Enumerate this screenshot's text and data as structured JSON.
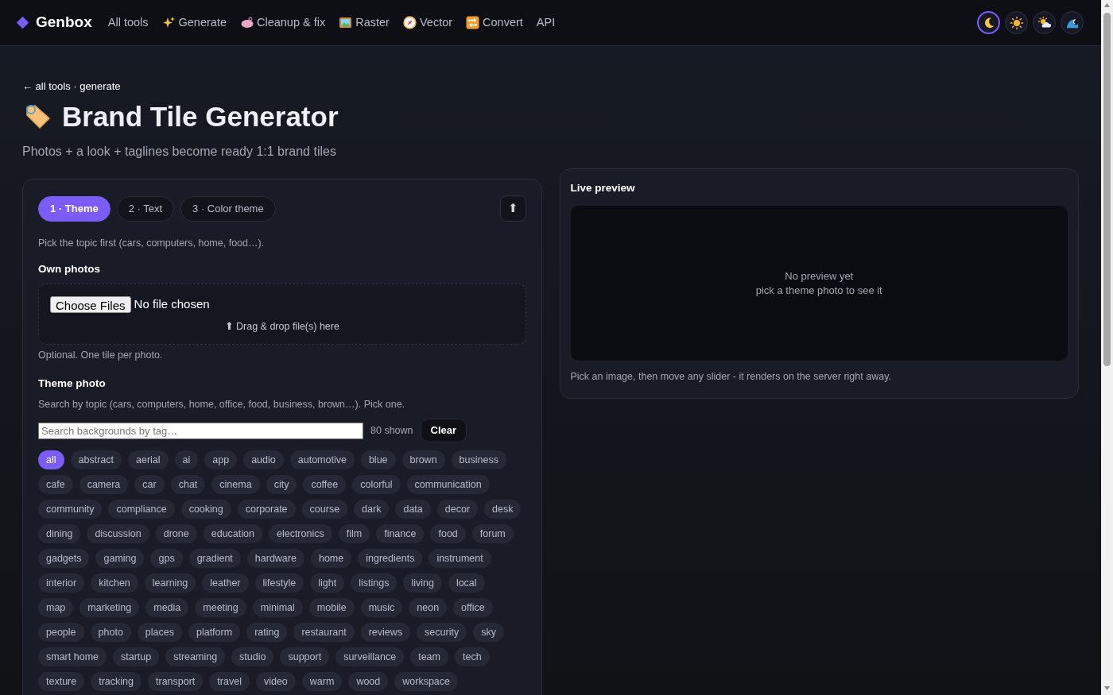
{
  "brand": {
    "name": "Genbox"
  },
  "nav": [
    {
      "label": "All tools",
      "kind": "plain"
    },
    {
      "label": "Generate",
      "kind": "sparkles"
    },
    {
      "label": "Cleanup & fix",
      "kind": "soap"
    },
    {
      "label": "Raster",
      "kind": "picture"
    },
    {
      "label": "Vector",
      "kind": "compass"
    },
    {
      "label": "Convert",
      "kind": "repeat"
    },
    {
      "label": "API",
      "kind": "plain"
    }
  ],
  "themes": [
    {
      "kind": "moon",
      "selected": true
    },
    {
      "kind": "sun",
      "selected": false
    },
    {
      "kind": "sun-cloud",
      "selected": false
    },
    {
      "kind": "wave",
      "selected": false
    }
  ],
  "breadcrumb": "← all tools · generate",
  "page_title": "Brand Tile Generator",
  "subtitle": "Photos + a look + taglines become ready 1:1 brand tiles",
  "steps": [
    {
      "label": "1 · Theme",
      "selected": true
    },
    {
      "label": "2 · Text",
      "selected": false
    },
    {
      "label": "3 · Color theme",
      "selected": false
    }
  ],
  "upload_button": "⬆",
  "step_hint": "Pick the topic first (cars, computers, home, food…).",
  "own_photos": {
    "heading": "Own photos",
    "choose_button": "Choose Files",
    "file_status": "No file chosen",
    "drop_hint": "⬆ Drag & drop file(s) here",
    "note": "Optional. One tile per photo."
  },
  "theme_photo": {
    "heading": "Theme photo",
    "hint": "Search by topic (cars, computers, home, office, food, business, brown…). Pick one.",
    "search": {
      "placeholder": "Search backgrounds by tag…"
    },
    "count": "80 shown",
    "clear_button": "Clear",
    "tags": [
      {
        "label": "all",
        "selected": true
      },
      {
        "label": "abstract",
        "selected": false
      },
      {
        "label": "aerial",
        "selected": false
      },
      {
        "label": "ai",
        "selected": false
      },
      {
        "label": "app",
        "selected": false
      },
      {
        "label": "audio",
        "selected": false
      },
      {
        "label": "automotive",
        "selected": false
      },
      {
        "label": "blue",
        "selected": false
      },
      {
        "label": "brown",
        "selected": false
      },
      {
        "label": "business",
        "selected": false
      },
      {
        "label": "cafe",
        "selected": false
      },
      {
        "label": "camera",
        "selected": false
      },
      {
        "label": "car",
        "selected": false
      },
      {
        "label": "chat",
        "selected": false
      },
      {
        "label": "cinema",
        "selected": false
      },
      {
        "label": "city",
        "selected": false
      },
      {
        "label": "coffee",
        "selected": false
      },
      {
        "label": "colorful",
        "selected": false
      },
      {
        "label": "communication",
        "selected": false
      },
      {
        "label": "community",
        "selected": false
      },
      {
        "label": "compliance",
        "selected": false
      },
      {
        "label": "cooking",
        "selected": false
      },
      {
        "label": "corporate",
        "selected": false
      },
      {
        "label": "course",
        "selected": false
      },
      {
        "label": "dark",
        "selected": false
      },
      {
        "label": "data",
        "selected": false
      },
      {
        "label": "decor",
        "selected": false
      },
      {
        "label": "desk",
        "selected": false
      },
      {
        "label": "dining",
        "selected": false
      },
      {
        "label": "discussion",
        "selected": false
      },
      {
        "label": "drone",
        "selected": false
      },
      {
        "label": "education",
        "selected": false
      },
      {
        "label": "electronics",
        "selected": false
      },
      {
        "label": "film",
        "selected": false
      },
      {
        "label": "finance",
        "selected": false
      },
      {
        "label": "food",
        "selected": false
      },
      {
        "label": "forum",
        "selected": false
      },
      {
        "label": "gadgets",
        "selected": false
      },
      {
        "label": "gaming",
        "selected": false
      },
      {
        "label": "gps",
        "selected": false
      },
      {
        "label": "gradient",
        "selected": false
      },
      {
        "label": "hardware",
        "selected": false
      },
      {
        "label": "home",
        "selected": false
      },
      {
        "label": "ingredients",
        "selected": false
      },
      {
        "label": "instrument",
        "selected": false
      },
      {
        "label": "interior",
        "selected": false
      },
      {
        "label": "kitchen",
        "selected": false
      },
      {
        "label": "learning",
        "selected": false
      },
      {
        "label": "leather",
        "selected": false
      },
      {
        "label": "lifestyle",
        "selected": false
      },
      {
        "label": "light",
        "selected": false
      },
      {
        "label": "listings",
        "selected": false
      },
      {
        "label": "living",
        "selected": false
      },
      {
        "label": "local",
        "selected": false
      },
      {
        "label": "map",
        "selected": false
      },
      {
        "label": "marketing",
        "selected": false
      },
      {
        "label": "media",
        "selected": false
      },
      {
        "label": "meeting",
        "selected": false
      },
      {
        "label": "minimal",
        "selected": false
      },
      {
        "label": "mobile",
        "selected": false
      },
      {
        "label": "music",
        "selected": false
      },
      {
        "label": "neon",
        "selected": false
      },
      {
        "label": "office",
        "selected": false
      },
      {
        "label": "people",
        "selected": false
      },
      {
        "label": "photo",
        "selected": false
      },
      {
        "label": "places",
        "selected": false
      },
      {
        "label": "platform",
        "selected": false
      },
      {
        "label": "rating",
        "selected": false
      },
      {
        "label": "restaurant",
        "selected": false
      },
      {
        "label": "reviews",
        "selected": false
      },
      {
        "label": "security",
        "selected": false
      },
      {
        "label": "sky",
        "selected": false
      },
      {
        "label": "smart home",
        "selected": false
      },
      {
        "label": "startup",
        "selected": false
      },
      {
        "label": "streaming",
        "selected": false
      },
      {
        "label": "studio",
        "selected": false
      },
      {
        "label": "support",
        "selected": false
      },
      {
        "label": "surveillance",
        "selected": false
      },
      {
        "label": "team",
        "selected": false
      },
      {
        "label": "tech",
        "selected": false
      },
      {
        "label": "texture",
        "selected": false
      },
      {
        "label": "tracking",
        "selected": false
      },
      {
        "label": "transport",
        "selected": false
      },
      {
        "label": "travel",
        "selected": false
      },
      {
        "label": "video",
        "selected": false
      },
      {
        "label": "warm",
        "selected": false
      },
      {
        "label": "wood",
        "selected": false
      },
      {
        "label": "workspace",
        "selected": false
      }
    ]
  },
  "preview": {
    "heading": "Live preview",
    "empty_title": "No preview yet",
    "empty_hint": "pick a theme photo to see it",
    "note": "Pick an image, then move any slider - it renders on the server right away."
  }
}
